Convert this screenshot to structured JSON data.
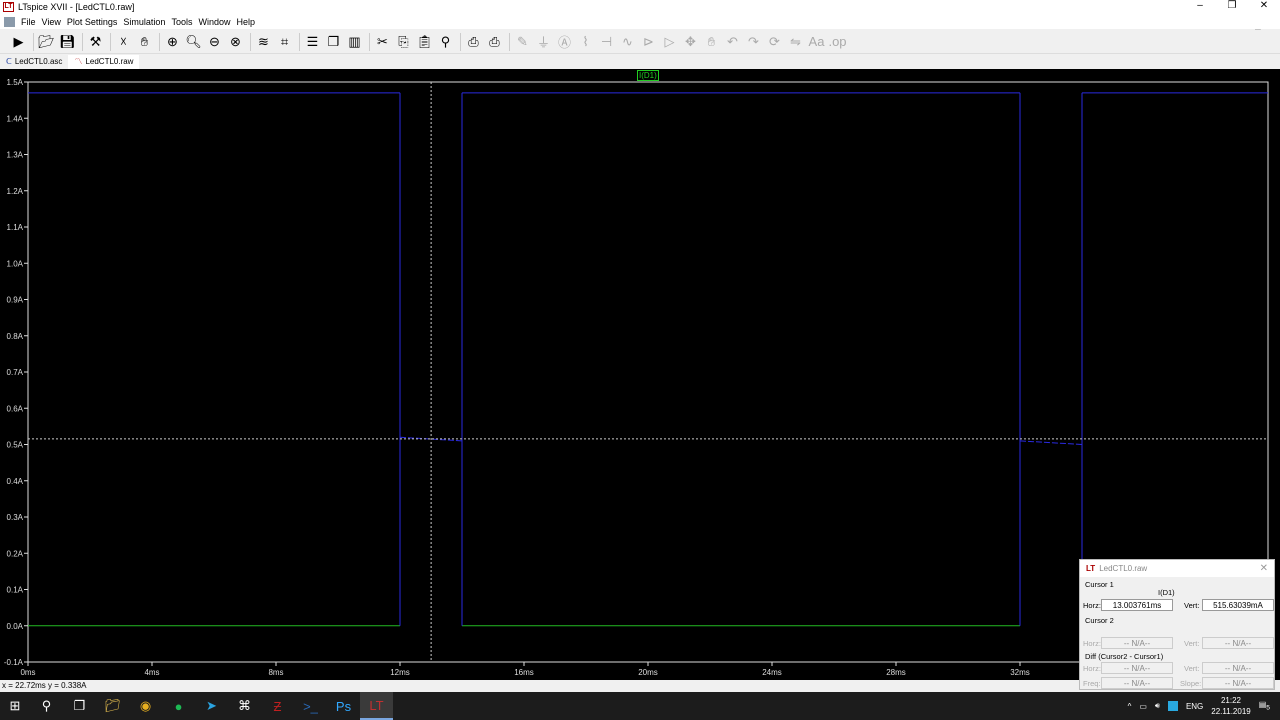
{
  "window": {
    "title": "LTspice XVII - [LedCTL0.raw]",
    "min": "–",
    "max": "❐",
    "close": "✕"
  },
  "menu": [
    "File",
    "View",
    "Plot Settings",
    "Simulation",
    "Tools",
    "Window",
    "Help"
  ],
  "toolbar_icons": [
    "run-icon",
    "open-icon",
    "save-icon",
    "control-panel-icon",
    "halt-icon",
    "pan-icon",
    "zoom-in-icon",
    "zoom-area-icon",
    "zoom-out-icon",
    "zoom-fit-icon",
    "autorange-icon",
    "mark-icon",
    "tile-horizontal-icon",
    "cascade-icon",
    "tile-vertical-icon",
    "cut-icon",
    "copy-icon",
    "paste-icon",
    "find-icon",
    "print-setup-icon",
    "print-icon",
    "draw-wire-icon",
    "ground-icon",
    "label-icon",
    "resistor-icon",
    "capacitor-icon",
    "inductor-icon",
    "diode-icon",
    "component-icon",
    "move-icon",
    "drag-icon",
    "undo-icon",
    "redo-icon",
    "rotate-icon",
    "mirror-icon",
    "text-icon",
    "spice-directive-icon"
  ],
  "tabs": [
    {
      "label": "LedCTL0.asc",
      "icon": "schematic-icon"
    },
    {
      "label": "LedCTL0.raw",
      "icon": "waveform-icon",
      "active": true
    }
  ],
  "plot": {
    "trace_label": "I(D1)",
    "colors": {
      "background": "#000000",
      "trace_high": "#2a2ae0",
      "trace_low": "#22bb22",
      "label": "#22cc22",
      "axis": "#ffffff"
    },
    "y_ticks": [
      "1.5A",
      "1.4A",
      "1.3A",
      "1.2A",
      "1.1A",
      "1.0A",
      "0.9A",
      "0.8A",
      "0.7A",
      "0.6A",
      "0.5A",
      "0.4A",
      "0.3A",
      "0.2A",
      "0.1A",
      "0.0A",
      "-0.1A"
    ],
    "x_ticks": [
      "0ms",
      "4ms",
      "8ms",
      "12ms",
      "16ms",
      "20ms",
      "24ms",
      "28ms",
      "32ms"
    ],
    "ylim": [
      -0.1,
      1.5
    ],
    "xlim": [
      0,
      40
    ],
    "segments": [
      {
        "t0": 0,
        "t1": 12,
        "high": 1.47,
        "low": 0.0
      },
      {
        "t0": 12,
        "t1": 14,
        "level_start": 0.52,
        "level_end": 0.51
      },
      {
        "t0": 14,
        "t1": 32,
        "high": 1.47,
        "low": 0.0
      },
      {
        "t0": 32,
        "t1": 34,
        "level_start": 0.51,
        "level_end": 0.5
      },
      {
        "t0": 34,
        "t1": 40,
        "high": 1.47,
        "low": 0.0
      }
    ],
    "cursor": {
      "x_ms": 13.003761,
      "y_A": 0.51563039
    }
  },
  "status": {
    "text": "x = 22.72ms   y = 0.338A"
  },
  "cursor_window": {
    "title": "LedCTL0.raw",
    "close": "✕",
    "cursor1": "Cursor 1",
    "trace": "I(D1)",
    "horz_label": "Horz:",
    "vert_label": "Vert:",
    "horz1": "13.003761ms",
    "vert1": "515.63039mA",
    "cursor2": "Cursor 2",
    "horz2": "-- N/A--",
    "vert2": "-- N/A--",
    "diff": "Diff (Cursor2 - Cursor1)",
    "dhorz": "-- N/A--",
    "dvert": "-- N/A--",
    "freq_label": "Freq:",
    "slope_label": "Slope:",
    "freq": "-- N/A--",
    "slope": "-- N/A--"
  },
  "taskbar": {
    "apps": [
      "start-icon",
      "search-icon",
      "task-view-icon",
      "file-explorer-icon",
      "chrome-icon",
      "spotify-icon",
      "telegram-icon",
      "network-tool-icon",
      "filezilla-icon",
      "powershell-icon",
      "photoshop-icon",
      "ltspice-icon"
    ],
    "lang": "ENG",
    "time": "21:22",
    "date": "22.11.2019",
    "notifications": "5"
  }
}
